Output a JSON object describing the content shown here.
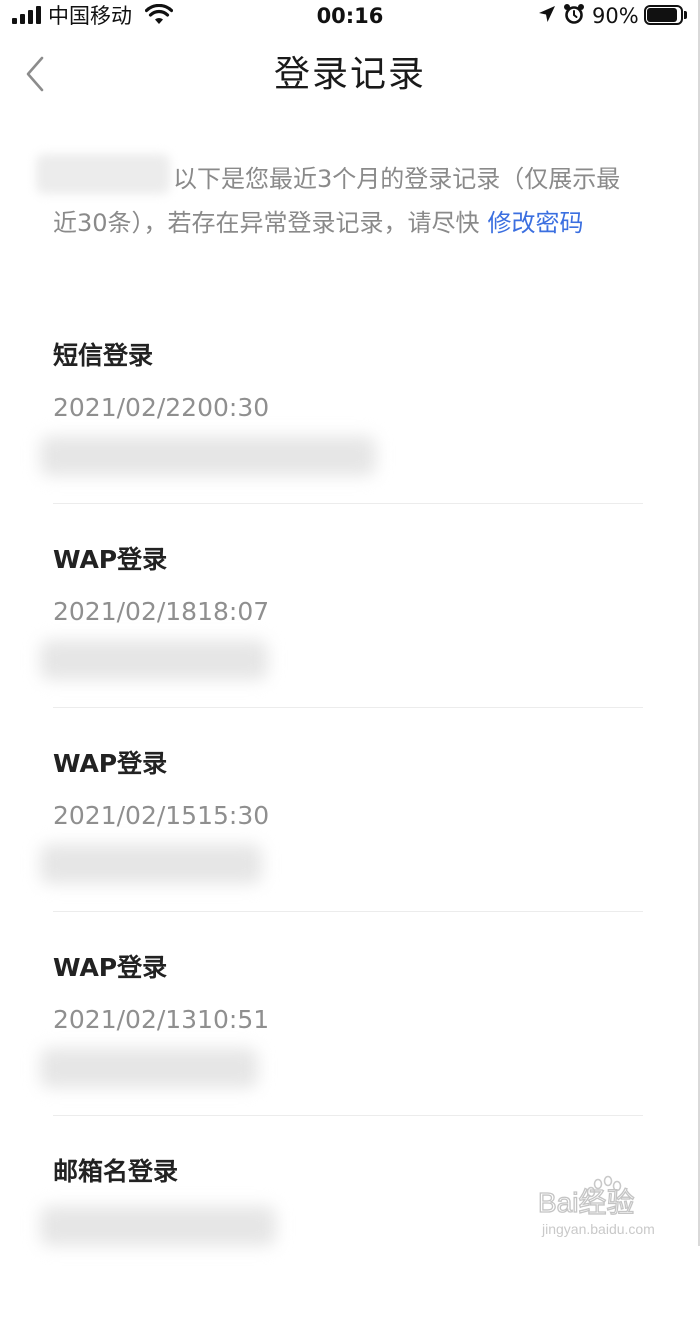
{
  "status_bar": {
    "carrier": "中国移动",
    "time": "00:16",
    "battery_percent": "90%",
    "battery_level": 0.9
  },
  "nav": {
    "title": "登录记录",
    "back_icon": "chevron-left-icon"
  },
  "intro": {
    "line1": "以下是您最近3个月的登录记录（仅展示最",
    "line2": "近30条），若存在异常登录记录，请尽快",
    "link": "修改密码"
  },
  "records": [
    {
      "type": "短信登录",
      "time": "2021/02/2200:30"
    },
    {
      "type": "WAP登录",
      "time": "2021/02/1818:07"
    },
    {
      "type": "WAP登录",
      "time": "2021/02/1515:30"
    },
    {
      "type": "WAP登录",
      "time": "2021/02/1310:51"
    },
    {
      "type": "邮箱名登录",
      "time": ""
    }
  ],
  "watermark": {
    "text": "Bai经验",
    "url_text": "jingyan.baidu.com"
  }
}
